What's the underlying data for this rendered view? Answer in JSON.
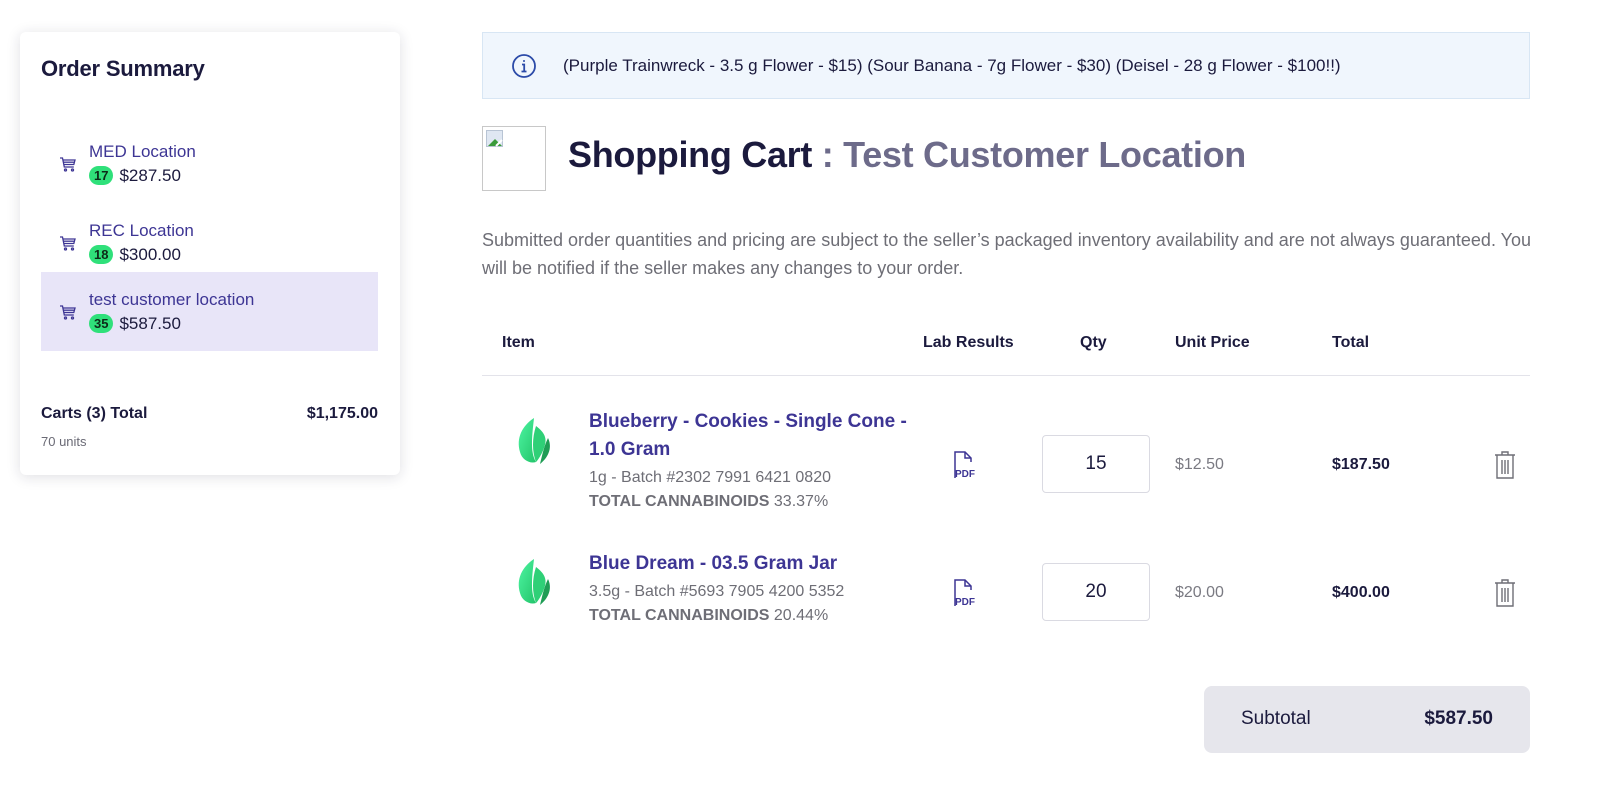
{
  "sidebar": {
    "title": "Order Summary",
    "carts": [
      {
        "name": "MED Location",
        "units": "17",
        "amount": "$287.50",
        "active": false
      },
      {
        "name": "REC Location",
        "units": "18",
        "amount": "$300.00",
        "active": false
      },
      {
        "name": "test customer location",
        "units": "35",
        "amount": "$587.50",
        "active": true
      }
    ],
    "totals_label": "Carts (3) Total",
    "totals_value": "$1,175.00",
    "units_label": "70 units"
  },
  "banner": {
    "icon": "info-icon",
    "text": "(Purple Trainwreck - 3.5 g Flower - $15) (Sour Banana - 7g Flower - $30) (Deisel - 28 g Flower - $100!!)"
  },
  "header": {
    "title": "Shopping Cart",
    "separator": " : ",
    "location": "Test Customer Location"
  },
  "notice": "Submitted order quantities and pricing are subject to the seller’s packaged inventory availability and are not always guaranteed. You will be notified if the seller makes any changes to your order.",
  "table": {
    "columns": [
      "Item",
      "Lab Results",
      "Qty",
      "Unit Price",
      "Total"
    ],
    "rows": [
      {
        "name": "Blueberry - Cookies - Single Cone - 1.0 Gram",
        "batch": "1g - Batch #2302 7991 6421 0820",
        "cannabinoids_label": "TOTAL CANNABINOIDS",
        "cannabinoids_value": " 33.37%",
        "lab_icon": "pdf-icon",
        "qty": "15",
        "unit_price": "$12.50",
        "total": "$187.50"
      },
      {
        "name": "Blue Dream - 03.5 Gram Jar",
        "batch": "3.5g - Batch #5693 7905 4200 5352",
        "cannabinoids_label": "TOTAL CANNABINOIDS",
        "cannabinoids_value": " 20.44%",
        "lab_icon": "pdf-icon",
        "qty": "20",
        "unit_price": "$20.00",
        "total": "$400.00"
      }
    ]
  },
  "subtotal": {
    "label": "Subtotal",
    "value": "$587.50"
  },
  "colors": {
    "brand_purple": "#3d3594",
    "badge_green": "#2fe07a",
    "active_item_bg": "#e8e5f8",
    "banner_bg": "#f0f6fd"
  }
}
